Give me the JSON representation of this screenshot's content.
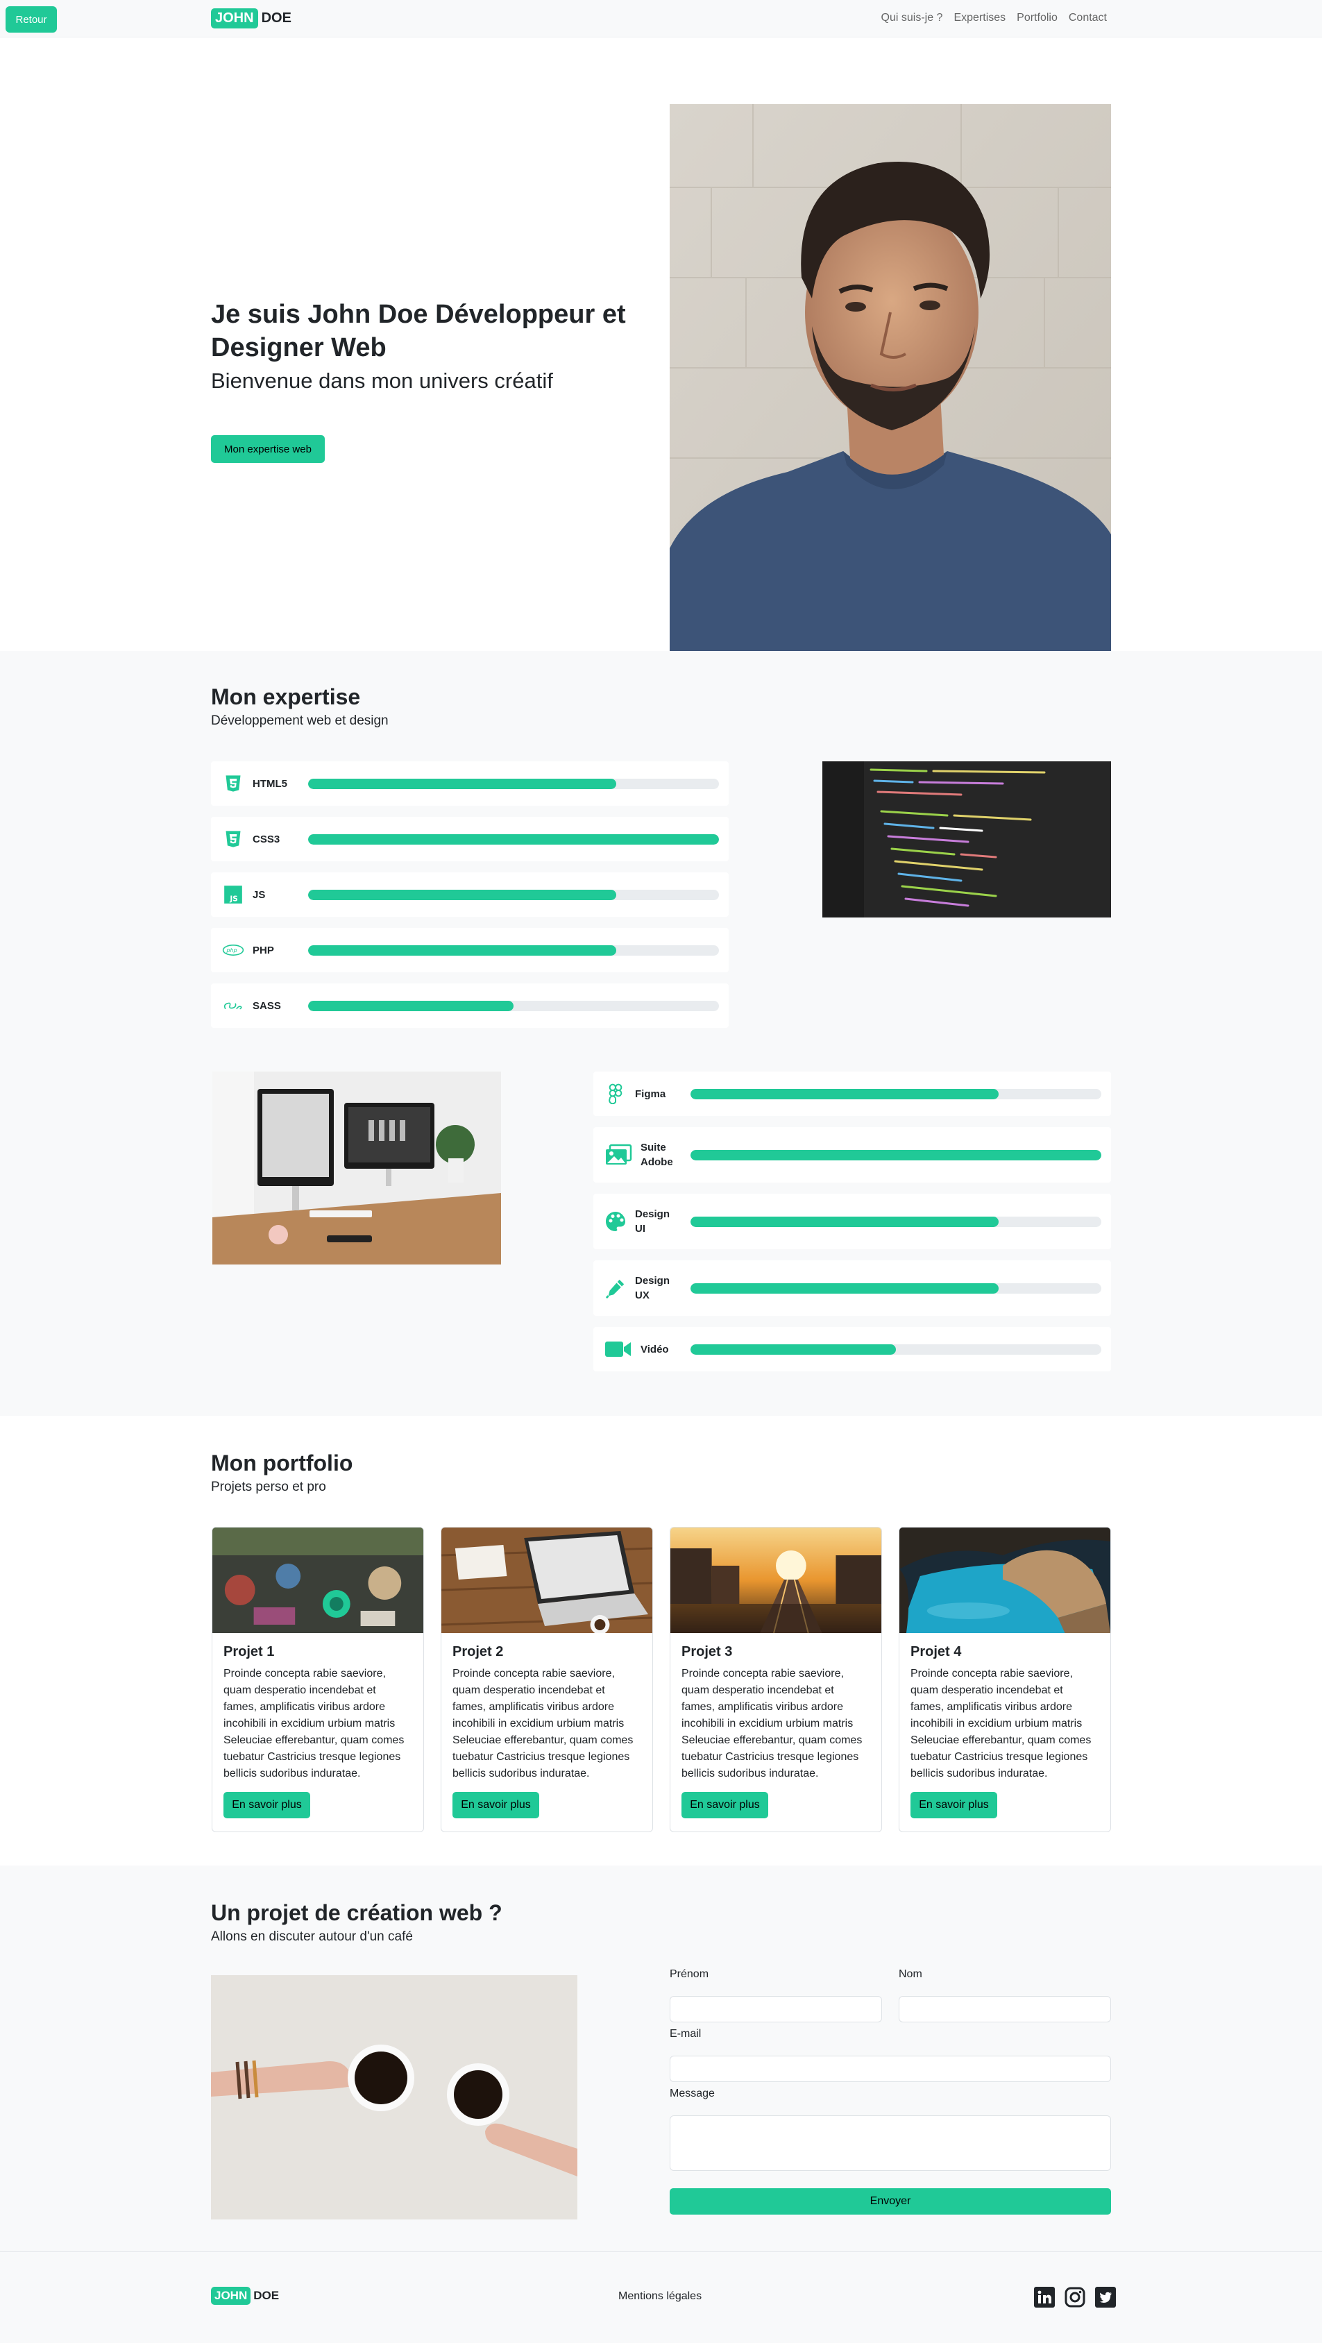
{
  "navbar": {
    "back_label": "Retour",
    "brand_box": "JOHN",
    "brand_rest": "DOE",
    "links": [
      "Qui suis-je ?",
      "Expertises",
      "Portfolio",
      "Contact"
    ]
  },
  "hero": {
    "title": "Je suis John Doe Développeur et Designer Web",
    "subtitle": "Bienvenue dans mon univers créatif",
    "button": "Mon expertise web"
  },
  "expertise": {
    "title": "Mon expertise",
    "subtitle": "Développement web et design",
    "dev_skills": [
      {
        "name": "HTML5",
        "icon": "html5-icon",
        "level": 0.75
      },
      {
        "name": "CSS3",
        "icon": "css3-icon",
        "level": 1.0
      },
      {
        "name": "JS",
        "icon": "js-icon",
        "level": 0.75
      },
      {
        "name": "PHP",
        "icon": "php-icon",
        "level": 0.75
      },
      {
        "name": "SASS",
        "icon": "sass-icon",
        "level": 0.5
      }
    ],
    "design_skills": [
      {
        "name": "Figma",
        "icon": "figma-icon",
        "level": 0.75
      },
      {
        "name": "Suite Adobe",
        "icon": "images-icon",
        "level": 1.0
      },
      {
        "name": "Design UI",
        "icon": "palette-icon",
        "level": 0.75
      },
      {
        "name": "Design UX",
        "icon": "pen-icon",
        "level": 0.75
      },
      {
        "name": "Vidéo",
        "icon": "video-camera-icon",
        "level": 0.5
      }
    ]
  },
  "portfolio": {
    "title": "Mon portfolio",
    "subtitle": "Projets perso et pro",
    "cards": [
      {
        "title": "Projet 1",
        "text": "Proinde concepta rabie saeviore, quam desperatio incendebat et fames, amplificatis viribus ardore incohibili in excidium urbium matris Seleuciae efferebantur, quam comes tuebatur Castricius tresque legiones bellicis sudoribus induratae.",
        "button": "En savoir plus"
      },
      {
        "title": "Projet 2",
        "text": "Proinde concepta rabie saeviore, quam desperatio incendebat et fames, amplificatis viribus ardore incohibili in excidium urbium matris Seleuciae efferebantur, quam comes tuebatur Castricius tresque legiones bellicis sudoribus induratae.",
        "button": "En savoir plus"
      },
      {
        "title": "Projet 3",
        "text": "Proinde concepta rabie saeviore, quam desperatio incendebat et fames, amplificatis viribus ardore incohibili in excidium urbium matris Seleuciae efferebantur, quam comes tuebatur Castricius tresque legiones bellicis sudoribus induratae.",
        "button": "En savoir plus"
      },
      {
        "title": "Projet 4",
        "text": "Proinde concepta rabie saeviore, quam desperatio incendebat et fames, amplificatis viribus ardore incohibili in excidium urbium matris Seleuciae efferebantur, quam comes tuebatur Castricius tresque legiones bellicis sudoribus induratae.",
        "button": "En savoir plus"
      }
    ]
  },
  "contact": {
    "title": "Un projet de création web ?",
    "subtitle": "Allons en discuter autour d'un café",
    "label_firstname": "Prénom",
    "label_lastname": "Nom",
    "label_email": "E-mail",
    "label_message": "Message",
    "button": "Envoyer"
  },
  "footer": {
    "brand_box": "JOHN",
    "brand_rest": "DOE",
    "legal": "Mentions légales",
    "socials": [
      "linkedin-icon",
      "instagram-icon",
      "twitter-icon"
    ]
  },
  "colors": {
    "accent": "#20c997",
    "light_bg": "#f8f9fa",
    "text": "#212529"
  }
}
